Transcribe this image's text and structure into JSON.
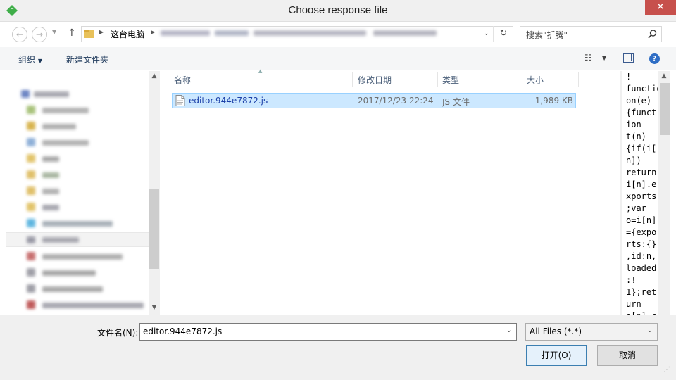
{
  "window": {
    "title": "Choose response file",
    "close_glyph": "✕",
    "app_icon_letter": "F"
  },
  "address": {
    "path_root": "这台电脑",
    "search_placeholder": "搜索\"折腾\""
  },
  "toolbar": {
    "organize": "组织",
    "new_folder": "新建文件夹"
  },
  "columns": {
    "name": "名称",
    "date": "修改日期",
    "type": "类型",
    "size": "大小"
  },
  "files": [
    {
      "name": "editor.944e7872.js",
      "date": "2017/12/23 22:24",
      "type": "JS 文件",
      "size": "1,989 KB"
    }
  ],
  "preview_lines": [
    "!",
    "function",
    "on(e)",
    "{funct",
    "ion",
    "t(n)",
    "{if(i[",
    "n])",
    "return",
    "i[n].e",
    "xports",
    ";var",
    "o=i[n]",
    "={expo",
    "rts:{}",
    ",id:n,",
    "loaded",
    ":!",
    "1};ret",
    "urn",
    "o[n].c"
  ],
  "bottom": {
    "filename_label": "文件名(N):",
    "filename_value": "editor.944e7872.js",
    "filter_value": "All Files (*.*)",
    "open_label": "打开(O)",
    "cancel_label": "取消"
  }
}
